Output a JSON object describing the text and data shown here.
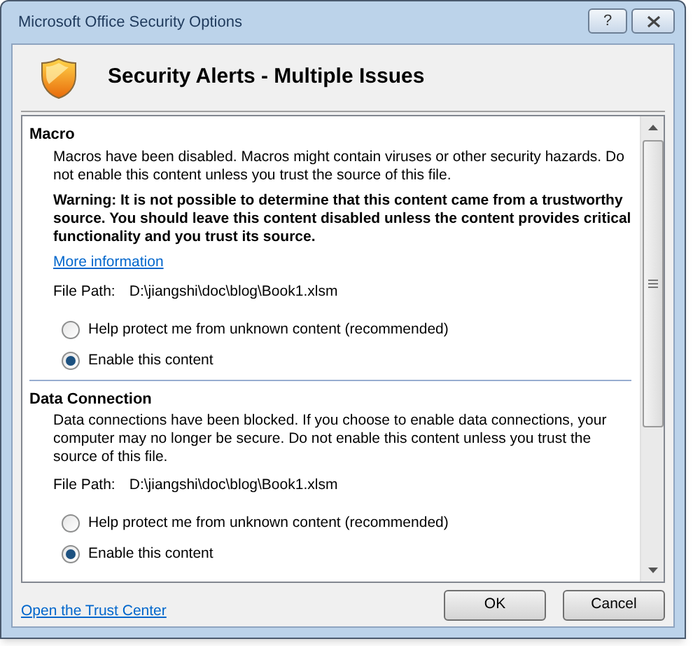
{
  "window": {
    "title": "Microsoft Office Security Options",
    "help": "?"
  },
  "header": {
    "title": "Security Alerts - Multiple Issues"
  },
  "sections": [
    {
      "heading": "Macro",
      "message": "Macros have been disabled. Macros might contain viruses or other security hazards. Do not enable this content unless you trust the source of this file.",
      "warning": "Warning: It is not possible to determine that this content came from a trustworthy source. You should leave this content disabled unless the content provides critical functionality and you trust its source.",
      "link": "More information",
      "file_path_label": "File Path:",
      "file_path": "D:\\jiangshi\\doc\\blog\\Book1.xlsm",
      "options": [
        {
          "label": "Help protect me from unknown content (recommended)",
          "selected": false
        },
        {
          "label": "Enable this content",
          "selected": true
        }
      ]
    },
    {
      "heading": "Data Connection",
      "message": "Data connections have been blocked. If you choose to enable data connections, your computer may no longer be secure. Do not enable this content unless you trust the source of this file.",
      "file_path_label": "File Path:",
      "file_path": "D:\\jiangshi\\doc\\blog\\Book1.xlsm",
      "options": [
        {
          "label": "Help protect me from unknown content (recommended)",
          "selected": false
        },
        {
          "label": "Enable this content",
          "selected": true
        }
      ]
    }
  ],
  "footer": {
    "link": "Open the Trust Center",
    "buttons": [
      "OK",
      "Cancel"
    ]
  }
}
